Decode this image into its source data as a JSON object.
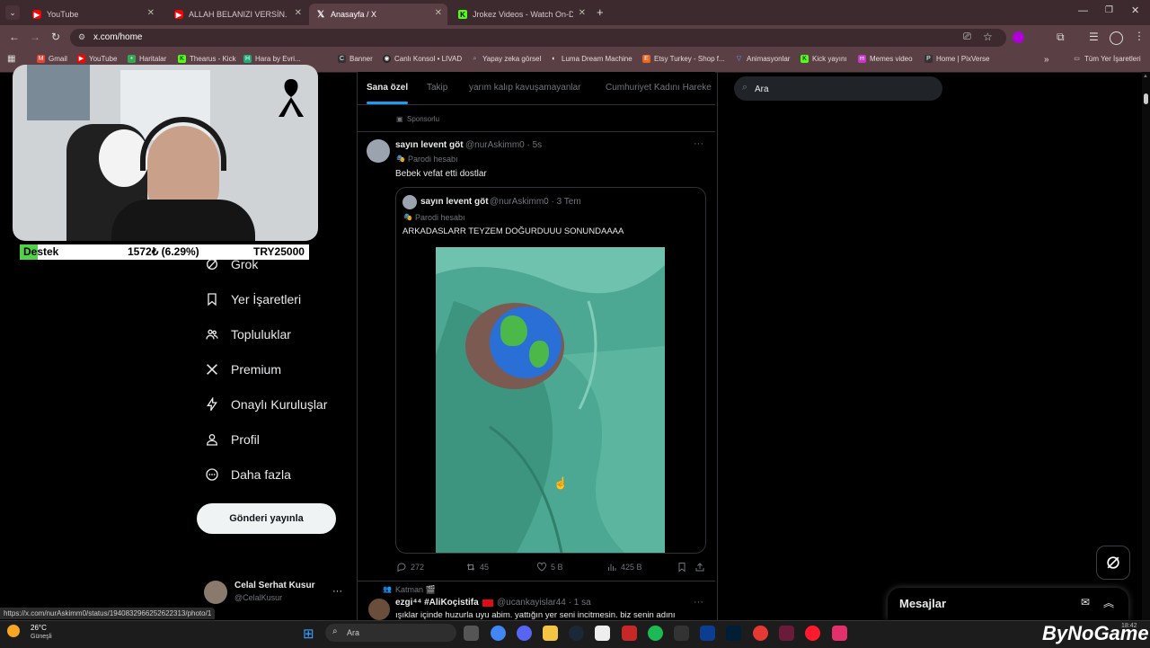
{
  "browser": {
    "tabs": [
      {
        "title": "YouTube"
      },
      {
        "title": "ALLAH BELANIZI VERSİN. - You"
      },
      {
        "title": "Anasayfa / X"
      },
      {
        "title": "Jrokez Videos - Watch On-Dem"
      }
    ],
    "url": "x.com/home",
    "bookmarks": [
      "Gmail",
      "YouTube",
      "Haritalar",
      "Thearus - Kick",
      "Hara by Evri...",
      "Banner",
      "Canlı Konsol • LIVAD",
      "Yapay zeka görsel",
      "Luma Dream Machine",
      "Etsy Turkey - Shop f...",
      "Animasyonlar",
      "Kick yayını",
      "Memes video",
      "Home | PixVerse"
    ],
    "all_bookmarks": "Tüm Yer İşaretleri",
    "status_url": "https://x.com/nurAskimm0/status/1940832966252622313/photo/1"
  },
  "nav": {
    "items": [
      "Grok",
      "Yer İşaretleri",
      "Topluluklar",
      "Premium",
      "Onaylı Kuruluşlar",
      "Profil",
      "Daha fazla"
    ],
    "post_button": "Gönderi yayınla",
    "user_name": "Celal Serhat Kusur",
    "user_handle": "@CelalKusur",
    "more": "···"
  },
  "feed": {
    "tabs": [
      "Sana özel",
      "Takip",
      "yarım kalıp kavuşamayanlar",
      "Cumhuriyet Kadını Hareke"
    ],
    "sponsored": "Sponsorlu",
    "post": {
      "name": "sayın levent göt",
      "handle": "@nurAskimm0 · 5s",
      "parody": "Parodi hesabı",
      "text": "Bebek vefat etti dostlar",
      "quote": {
        "name": "sayın levent göt",
        "handle": "@nurAskimm0 · 3 Tem",
        "parody": "Parodi hesabı",
        "text": "ARKADASLARR TEYZEM DOĞURDUUU SONUNDAAAA"
      },
      "actions": {
        "replies": "272",
        "reposts": "45",
        "likes": "5 B",
        "views": "425 B"
      }
    },
    "next_post": {
      "context": "Katman 🎬",
      "name": "ezgi⁴⁴ #AliKoçistifa",
      "handle": "@ucankayislar44 · 1 sa",
      "text": "ışıklar içinde huzurla uyu abim. yattığın yer seni incitmesin. biz senin adını"
    }
  },
  "right": {
    "search_placeholder": "Ara",
    "messages_title": "Mesajlar"
  },
  "stream": {
    "donation_label": "Destek",
    "donation_value": "1572₺ (6.29%)",
    "donation_goal": "TRY25000",
    "donation_progress": 0.0629,
    "watermark": "ByNoGame"
  },
  "taskbar": {
    "weather_temp": "26°C",
    "weather_desc": "Güneşli",
    "search": "Ara",
    "time": "18:42"
  },
  "colors": {
    "accent": "#1d9bf0",
    "chrome": "#5a3f45",
    "donation_fill": "#52d14a"
  }
}
